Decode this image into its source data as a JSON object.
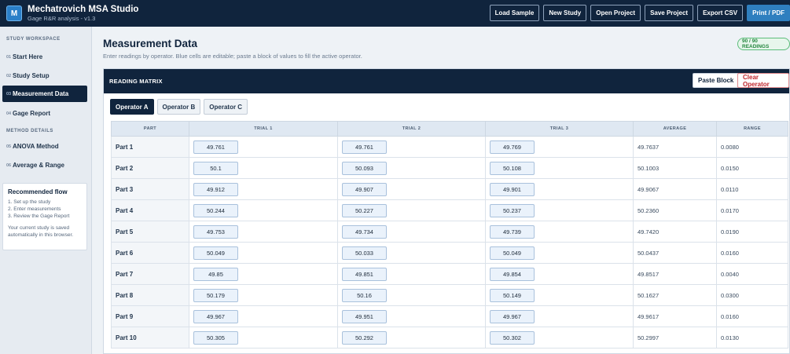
{
  "app": {
    "logo_letter": "M",
    "title": "Mechatrovich MSA Studio",
    "subtitle": "Gage R&R analysis - v1.3",
    "actions": [
      "Load Sample",
      "New Study",
      "Open Project",
      "Save Project",
      "Export CSV",
      "Print / PDF"
    ]
  },
  "sidebar": {
    "section1": "STUDY WORKSPACE",
    "section2": "METHOD DETAILS",
    "items": [
      {
        "num": "01",
        "label": "Start Here"
      },
      {
        "num": "02",
        "label": "Study Setup"
      },
      {
        "num": "03",
        "label": "Measurement Data"
      },
      {
        "num": "04",
        "label": "Gage Report"
      },
      {
        "num": "05",
        "label": "ANOVA Method"
      },
      {
        "num": "06",
        "label": "Average & Range"
      }
    ],
    "flow": {
      "title": "Recommended flow",
      "steps": [
        "1. Set up the study",
        "2. Enter measurements",
        "3. Review the Gage Report"
      ],
      "note": "Your current study is saved automatically in this browser."
    }
  },
  "main": {
    "title": "Measurement Data",
    "subtitle": "Enter readings by operator. Blue cells are editable; paste a block of values to fill the active operator.",
    "badge": "90 / 90 READINGS",
    "card": {
      "title": "READING MATRIX",
      "paste_label": "Paste Block",
      "clear_label": "Clear Operator"
    },
    "operators": [
      "Operator A",
      "Operator B",
      "Operator C"
    ],
    "columns": [
      "PART",
      "TRIAL 1",
      "TRIAL 2",
      "TRIAL 3",
      "AVERAGE",
      "RANGE"
    ],
    "rows": [
      {
        "part": "Part 1",
        "t1": "49.761",
        "t2": "49.761",
        "t3": "49.769",
        "avg": "49.7637",
        "range": "0.0080"
      },
      {
        "part": "Part 2",
        "t1": "50.1",
        "t2": "50.093",
        "t3": "50.108",
        "avg": "50.1003",
        "range": "0.0150"
      },
      {
        "part": "Part 3",
        "t1": "49.912",
        "t2": "49.907",
        "t3": "49.901",
        "avg": "49.9067",
        "range": "0.0110"
      },
      {
        "part": "Part 4",
        "t1": "50.244",
        "t2": "50.227",
        "t3": "50.237",
        "avg": "50.2360",
        "range": "0.0170"
      },
      {
        "part": "Part 5",
        "t1": "49.753",
        "t2": "49.734",
        "t3": "49.739",
        "avg": "49.7420",
        "range": "0.0190"
      },
      {
        "part": "Part 6",
        "t1": "50.049",
        "t2": "50.033",
        "t3": "50.049",
        "avg": "50.0437",
        "range": "0.0160"
      },
      {
        "part": "Part 7",
        "t1": "49.85",
        "t2": "49.851",
        "t3": "49.854",
        "avg": "49.8517",
        "range": "0.0040"
      },
      {
        "part": "Part 8",
        "t1": "50.179",
        "t2": "50.16",
        "t3": "50.149",
        "avg": "50.1627",
        "range": "0.0300"
      },
      {
        "part": "Part 9",
        "t1": "49.967",
        "t2": "49.951",
        "t3": "49.967",
        "avg": "49.9617",
        "range": "0.0160"
      },
      {
        "part": "Part 10",
        "t1": "50.305",
        "t2": "50.292",
        "t3": "50.302",
        "avg": "50.2997",
        "range": "0.0130"
      }
    ]
  }
}
